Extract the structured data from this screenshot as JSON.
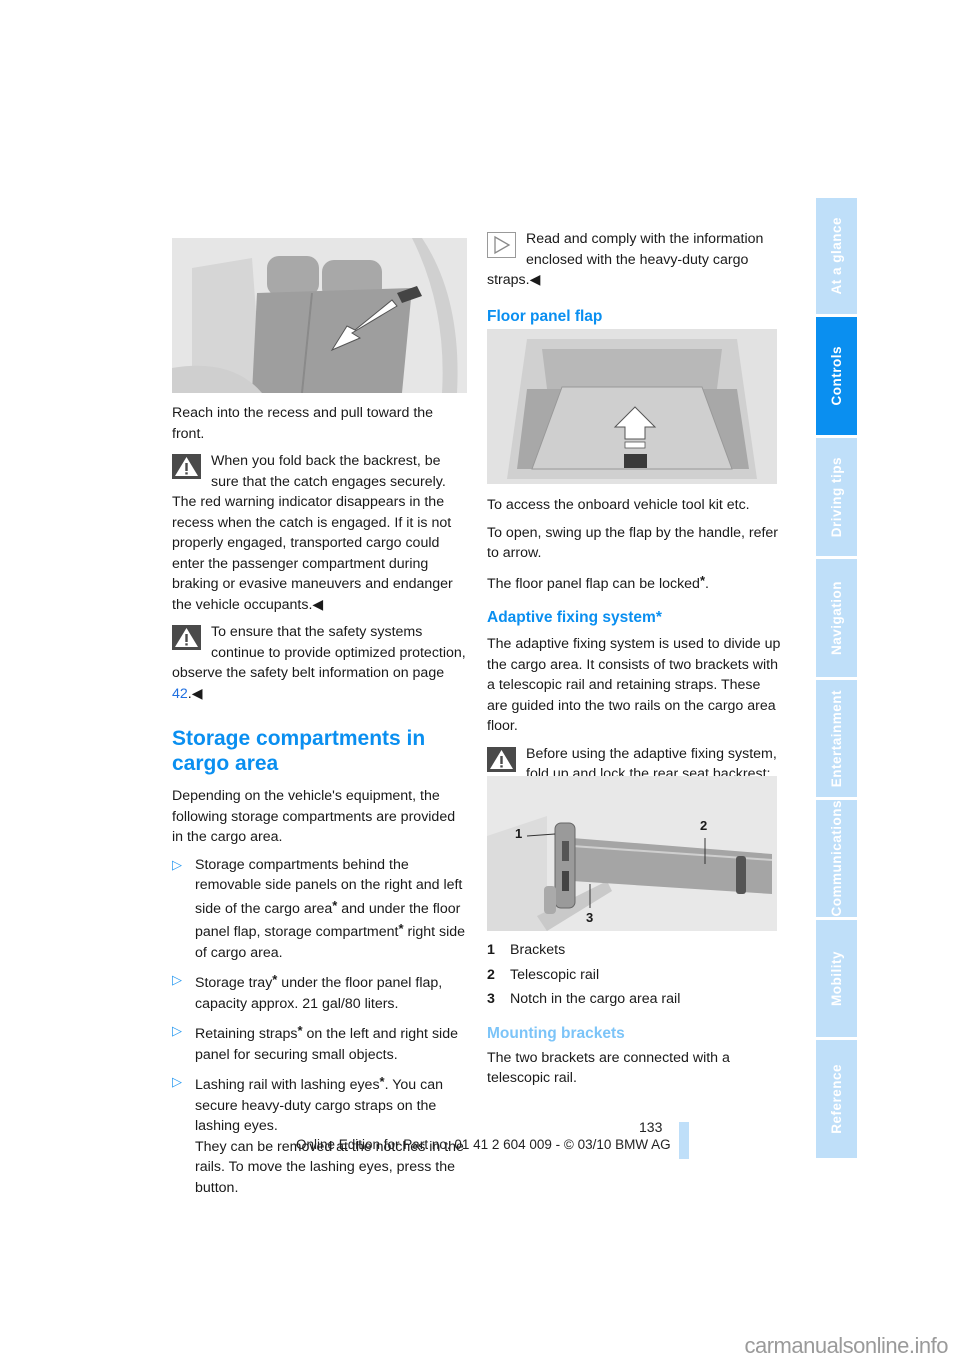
{
  "side_tabs": [
    {
      "label": "At a glance",
      "active": false
    },
    {
      "label": "Controls",
      "active": true
    },
    {
      "label": "Driving tips",
      "active": false
    },
    {
      "label": "Navigation",
      "active": false
    },
    {
      "label": "Entertainment",
      "active": false
    },
    {
      "label": "Communications",
      "active": false
    },
    {
      "label": "Mobility",
      "active": false
    },
    {
      "label": "Reference",
      "active": false
    }
  ],
  "left_column": {
    "seat_illustration_alt": "rear-seat-backrest-release",
    "reach_text": "Reach into the recess and pull toward the front.",
    "warning1": "When you fold back the backrest, be sure that the catch engages securely. The red warning indicator disappears in the recess when the catch is engaged. If it is not properly engaged, transported cargo could enter the passenger compartment during braking or evasive maneuvers and endanger the vehicle occupants.",
    "end_mark": "◀",
    "warning2_text": "To ensure that the safety systems continue to provide optimized protection, observe the safety belt information on page ",
    "warning2_link": "42",
    "section_title": "Storage compartments in cargo area",
    "intro": "Depending on the vehicle's equipment, the following storage compartments are provided in the cargo area.",
    "bullet_mark": "▷",
    "bullets": [
      {
        "parts": [
          "Storage compartments behind the removable side panels on the right and left side of the cargo area",
          " and under the floor panel flap, storage compartment",
          " right side of cargo area."
        ]
      },
      {
        "parts": [
          "Storage tray",
          " under the floor panel flap, capacity approx. 21 gal/80 liters."
        ]
      },
      {
        "parts": [
          "Retaining straps",
          " on the left and right side panel for securing small objects."
        ]
      },
      {
        "parts": [
          "Lashing rail with lashing eyes",
          ". You can secure heavy-duty cargo straps on the lashing eyes."
        ],
        "extra": "They can be removed at the notches in the rails. To move the lashing eyes, press the button."
      }
    ],
    "star": "*"
  },
  "right_column": {
    "note_text": "Read and comply with the information enclosed with the heavy-duty cargo straps.",
    "floor_title": "Floor panel flap",
    "floor_p1": "To access the onboard vehicle tool kit etc.",
    "floor_p2": "To open, swing up the flap by the handle, refer to arrow.",
    "floor_p3": "The floor panel flap can be locked",
    "adaptive_title": "Adaptive fixing system*",
    "adaptive_p1": "The adaptive fixing system is used to divide up the cargo area. It consists of two brackets with a telescopic rail and retaining straps. These are guided into the two rails on the cargo area floor.",
    "adaptive_warning": "Before using the adaptive fixing system, fold up and lock the rear seat backrest; otherwise, the cargo could be thrown into the vehicle interior in an accident.",
    "callouts": [
      "1",
      "2",
      "3"
    ],
    "legend": [
      {
        "num": "1",
        "label": "Brackets"
      },
      {
        "num": "2",
        "label": "Telescopic rail"
      },
      {
        "num": "3",
        "label": "Notch in the cargo area rail"
      }
    ],
    "mounting_title": "Mounting brackets",
    "mounting_p1": "The two brackets are connected with a telescopic rail."
  },
  "footer": {
    "page_number": "133",
    "edition": "Online Edition for Part no. 01 41 2 604 009 - © 03/10 BMW AG",
    "watermark": "carmanualsonline.info"
  }
}
